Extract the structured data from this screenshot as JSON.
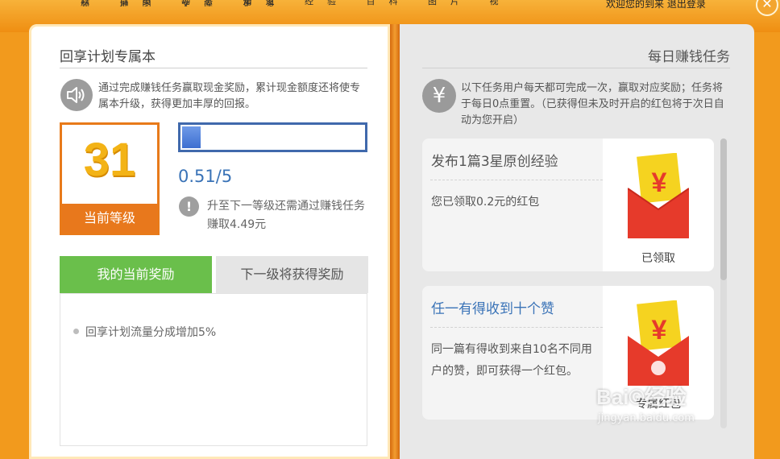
{
  "window": {
    "top_strip_text": "以 首页 动态 知道 经验 百科 图片 视频 地图 文库 更多",
    "top_right_text": "欢迎您的到来 退出登录",
    "close_symbol": "✕"
  },
  "left_page": {
    "title": "回享计划专属本",
    "intro": "通过完成赚钱任务赢取现金奖励，累计现金额度还将使专属本升级，获得更加丰厚的回报。",
    "level": {
      "number": "31",
      "label": "当前等级"
    },
    "progress": {
      "fraction": 0.102,
      "text": "0.51/5"
    },
    "upgrade_note": "升至下一等级还需通过赚钱任务赚取4.49元",
    "tabs": [
      {
        "label": "我的当前奖励",
        "active": true
      },
      {
        "label": "下一级将获得奖励",
        "active": false
      }
    ],
    "rewards": [
      "回享计划流量分成增加5%"
    ]
  },
  "right_page": {
    "title": "每日赚钱任务",
    "rules": "以下任务用户每天都可完成一次，赢取对应奖励；任务将于每日0点重置。（已获得但未及时开启的红包将于次日自动为您开启）",
    "tasks": [
      {
        "title": "发布1篇3星原创经验",
        "description": "您已领取0.2元的红包",
        "status": "已领取",
        "title_color": "#555555"
      },
      {
        "title": "任一有得收到十个赞",
        "description": "同一篇有得收到来自10名不同用户的赞，即可获得一个红包。",
        "status": "专属红包",
        "title_color": "#3a73b7"
      }
    ]
  },
  "watermark": {
    "main": "Bai©经验",
    "sub": "jingyan.baidu.com"
  },
  "colors": {
    "frame_orange": "#f29a1d",
    "level_orange": "#e8781c",
    "progress_blue": "#3d6fd0",
    "tab_green": "#6abf4b",
    "envelope_red": "#e63a2b",
    "envelope_gold": "#f5d320"
  },
  "icons": [
    "speaker-icon",
    "info-icon",
    "yen-icon",
    "red-envelope-icon",
    "close-icon"
  ]
}
